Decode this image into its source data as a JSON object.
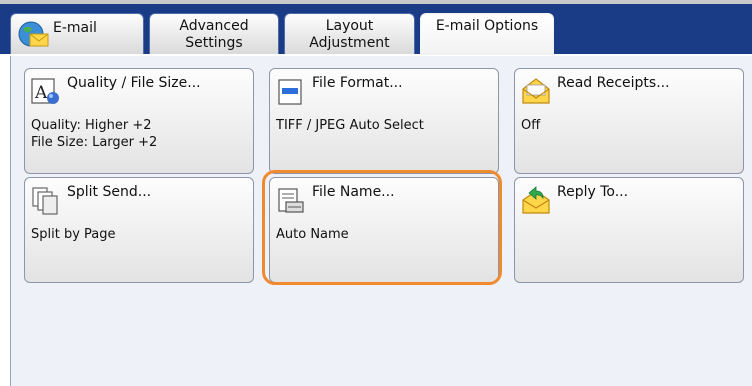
{
  "tabs": [
    {
      "label": "E-mail",
      "icon": "email-globe-icon"
    },
    {
      "label1": "Advanced",
      "label2": "Settings"
    },
    {
      "label1": "Layout",
      "label2": "Adjustment"
    },
    {
      "label": "E-mail Options",
      "active": true
    }
  ],
  "tiles": [
    {
      "title": "Quality / File Size...",
      "value": "Quality: Higher +2\nFile Size: Larger +2",
      "icon": "quality-icon"
    },
    {
      "title": "File Format...",
      "value": "TIFF / JPEG Auto Select",
      "icon": "file-format-icon"
    },
    {
      "title": "Read Receipts...",
      "value": "Off",
      "icon": "read-receipt-envelope-icon"
    },
    {
      "title": "Split Send...",
      "value": "Split by Page",
      "icon": "split-send-icon"
    },
    {
      "title": "File Name...",
      "value": "Auto Name",
      "icon": "file-name-icon"
    },
    {
      "title": "Reply To...",
      "value": "",
      "icon": "reply-envelope-icon"
    }
  ],
  "colors": {
    "tabbar": "#1a3c86",
    "highlight": "#f08a2e",
    "panel": "#eef1f7"
  }
}
